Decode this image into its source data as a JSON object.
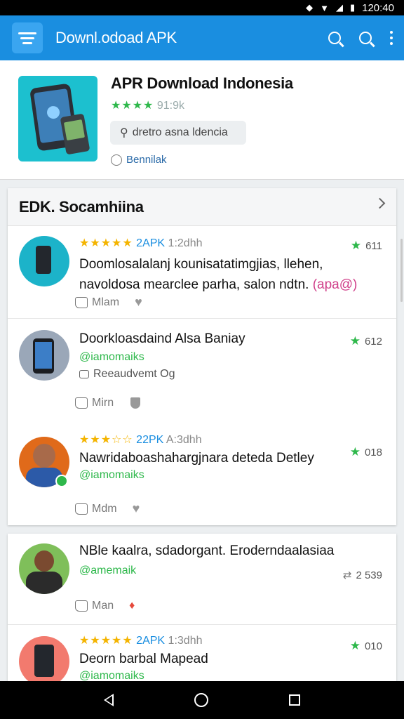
{
  "status_bar": {
    "time": "120:40"
  },
  "app_bar": {
    "title": "Downl.odoad APK",
    "accent": "#1a8ee0"
  },
  "app_card": {
    "title": "APR Download Indonesia",
    "stars": "★★★★",
    "rating_count": "91:9k",
    "chip_label": "dretro asna ldencia",
    "meta_label": "Bennilak"
  },
  "section": {
    "title": "EDK. Socamhiina"
  },
  "reviews": [
    {
      "stars": "★★★★★",
      "apk": "2APK",
      "time": "1:2dhh",
      "text_line1": "Doomlosalalanj kounisatatimgjias, llehen,",
      "text_line2": "navoldosa mearclee parha, salon ndtn.",
      "pink": "(apa@)",
      "like_label": "Mlam",
      "score": "611"
    },
    {
      "title": "Doorkloasdaind Alsa Baniay",
      "handle": "@iamomaiks",
      "sub": "Reeaudvemt Og",
      "like_label": "Mirn",
      "score": "612"
    },
    {
      "stars": "★★★☆☆",
      "apk": "22PK",
      "time": "A:3dhh",
      "text": "Nawridaboashahargjnara deteda Detley",
      "handle": "@iamomaiks",
      "like_label": "Mdm",
      "score": "018"
    },
    {
      "text": "NBle kaalra, sdadorgant. Eroderndaalasiaa",
      "handle": "@amemaik",
      "like_label": "Man",
      "score": "2 539"
    },
    {
      "stars": "★★★★★",
      "apk": "2APK",
      "time": "1:3dhh",
      "text": "Deorn barbal Mapead",
      "handle": "@iamomaiks",
      "score": "010"
    }
  ]
}
